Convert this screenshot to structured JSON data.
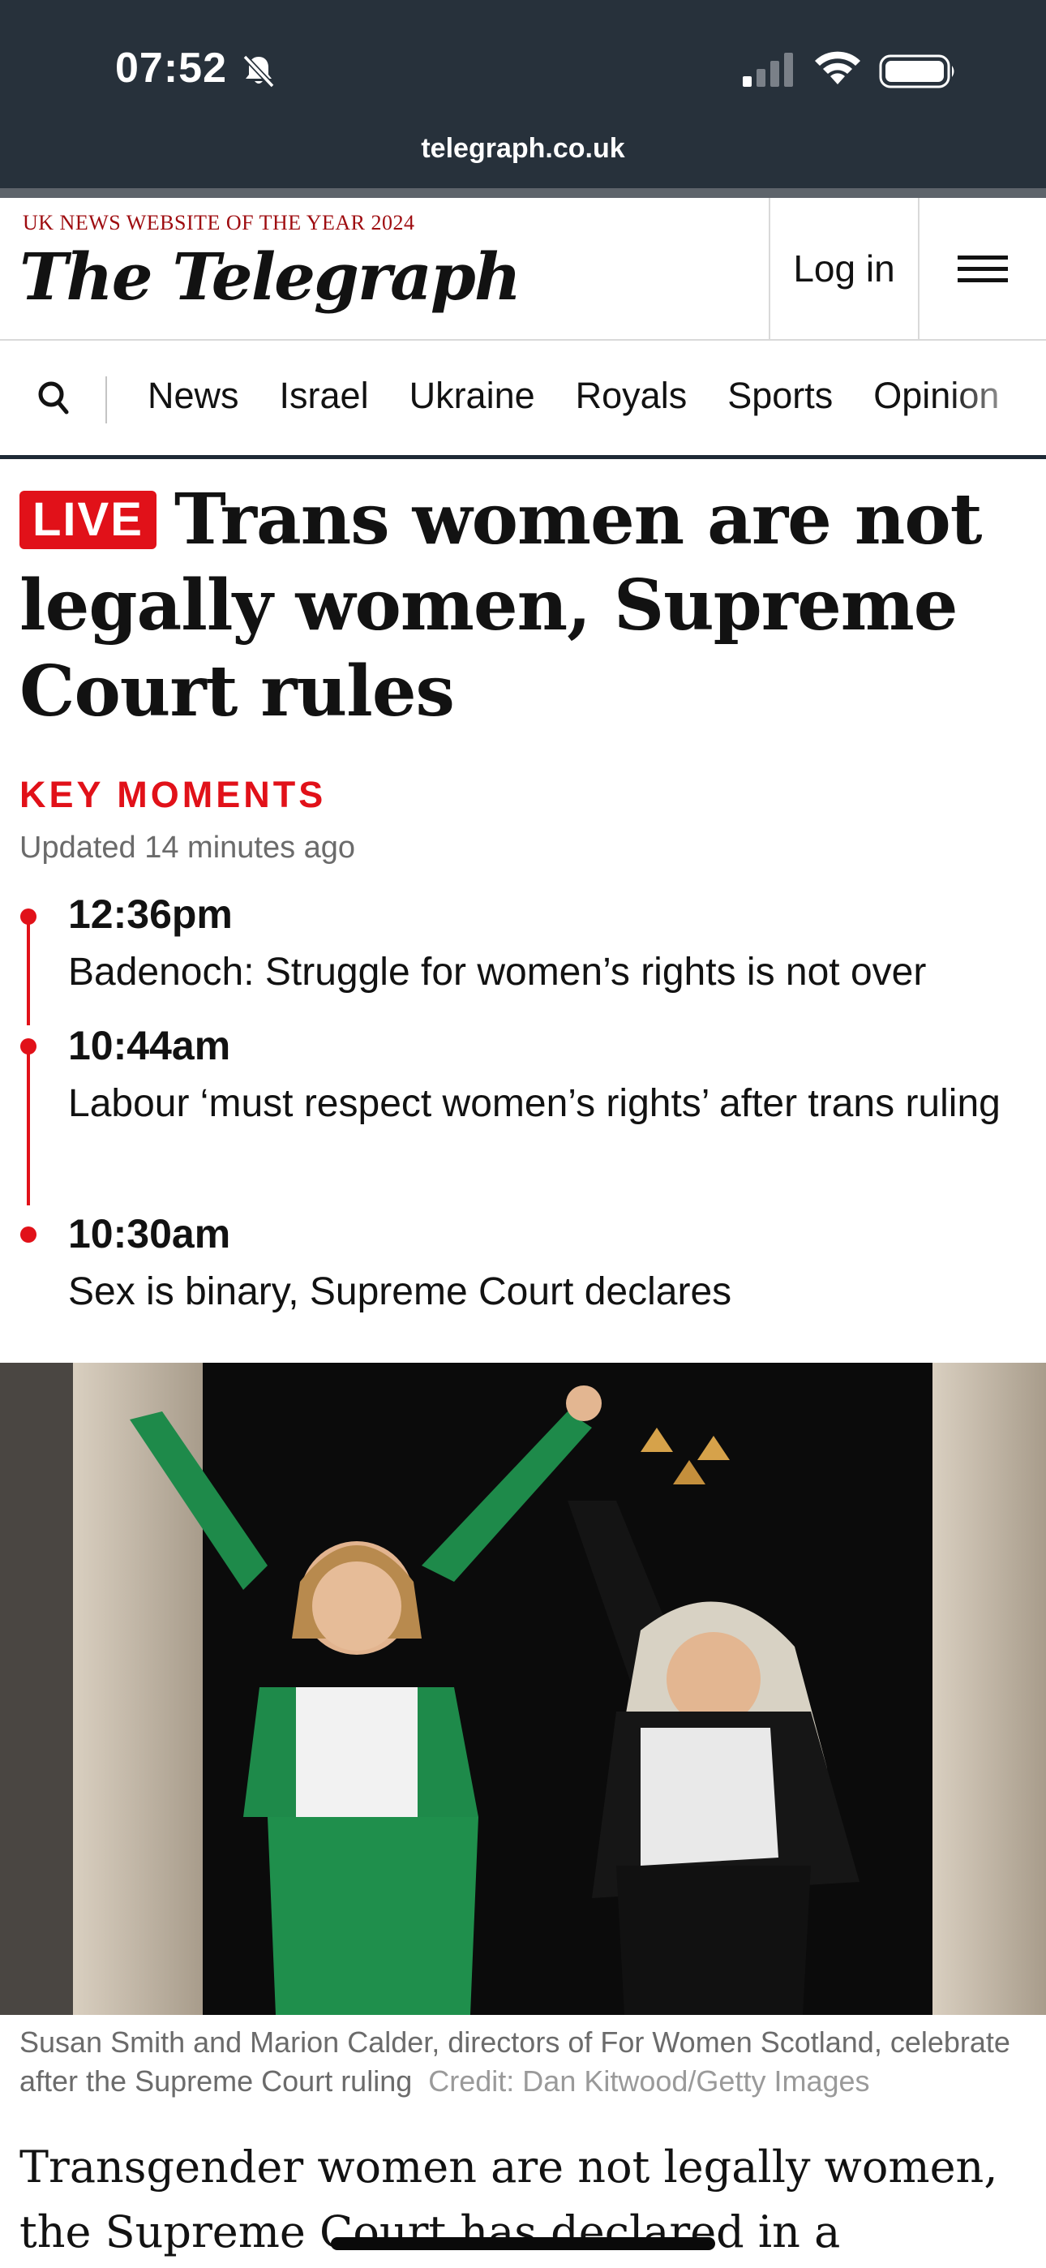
{
  "status_bar": {
    "time": "07:52",
    "url": "telegraph.co.uk"
  },
  "header": {
    "tagline": "UK NEWS WEBSITE OF THE YEAR 2024",
    "masthead": "The Telegraph",
    "login_label": "Log in"
  },
  "nav": {
    "items": [
      "News",
      "Israel",
      "Ukraine",
      "Royals",
      "Sports",
      "Opinion"
    ]
  },
  "article": {
    "live_label": "LIVE",
    "headline": "Trans women are not legally women, Supreme Court rules",
    "key_moments_title": "KEY MOMENTS",
    "updated": "Updated 14 minutes ago",
    "key_moments": [
      {
        "time": "12:36pm",
        "text": "Badenoch: Struggle for women’s rights is not over"
      },
      {
        "time": "10:44am",
        "text": "Labour ‘must respect women’s rights’ after trans ruling"
      },
      {
        "time": "10:30am",
        "text": "Sex is binary, Supreme Court declares"
      }
    ],
    "caption": "Susan Smith and Marion Calder, directors of For Women Scotland, celebrate after the Supreme Court ruling",
    "credit": "Credit: Dan Kitwood/Getty Images",
    "body_start": "Transgender women are not legally women, the Supreme Court has declared in a landmark"
  },
  "colors": {
    "accent": "#e11119",
    "chrome": "#27313b",
    "text": "#121212"
  },
  "icons": [
    "bell-slash-icon",
    "signal-icon",
    "wifi-icon",
    "battery-icon",
    "hamburger-menu-icon",
    "search-icon"
  ]
}
